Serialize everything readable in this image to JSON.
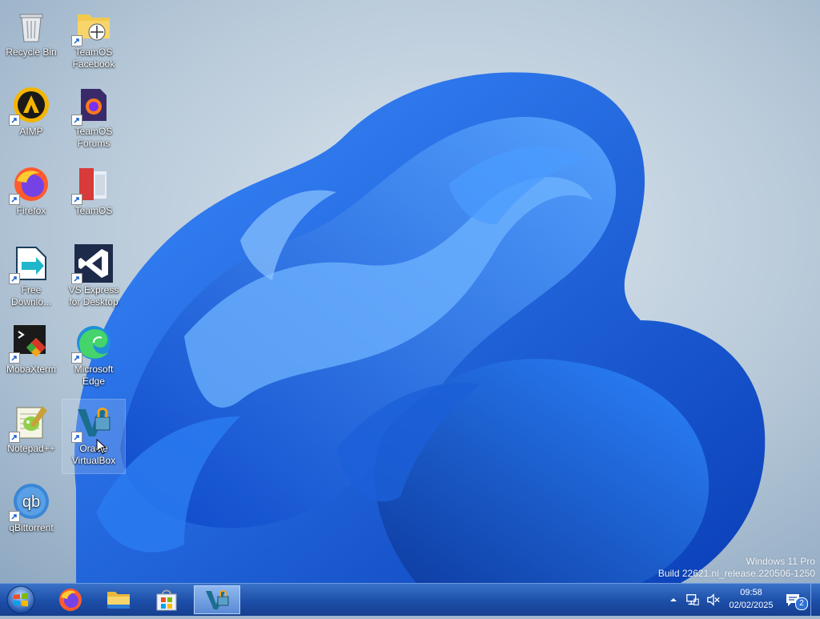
{
  "desktop": {
    "icons": [
      {
        "label": "Recycle Bin",
        "icon": "recycle-bin-icon"
      },
      {
        "label": "TeamOS Facebook",
        "icon": "folder-shortcut-icon"
      },
      {
        "label": "AIMP",
        "icon": "aimp-icon"
      },
      {
        "label": "TeamOS Forums",
        "icon": "firefox-document-icon"
      },
      {
        "label": "Firefox",
        "icon": "firefox-icon"
      },
      {
        "label": "TeamOS",
        "icon": "teamos-icon"
      },
      {
        "label": "Free Downlo...",
        "icon": "free-download-manager-icon"
      },
      {
        "label": "VS Express for Desktop",
        "icon": "visual-studio-icon"
      },
      {
        "label": "MobaXterm",
        "icon": "mobaxterm-icon"
      },
      {
        "label": "Microsoft Edge",
        "icon": "edge-icon"
      },
      {
        "label": "Notepad++",
        "icon": "notepad-plus-plus-icon"
      },
      {
        "label": "Oracle VirtualBox",
        "icon": "virtualbox-icon"
      },
      {
        "label": "qBittorrent",
        "icon": "qbittorrent-icon"
      }
    ]
  },
  "taskbar": {
    "pinned": [
      {
        "name": "Start",
        "icon": "windows-start-icon"
      },
      {
        "name": "Firefox",
        "icon": "firefox-icon"
      },
      {
        "name": "File Explorer",
        "icon": "folder-icon"
      },
      {
        "name": "Microsoft Store",
        "icon": "store-icon"
      },
      {
        "name": "Oracle VirtualBox",
        "icon": "virtualbox-icon",
        "active": true
      }
    ],
    "tray": {
      "clock_time": "09:58",
      "clock_date": "02/02/2025",
      "notification_count": "2"
    }
  },
  "watermark": {
    "line1": "Windows 11 Pro",
    "line2": "Build 22621.ni_release.220506-1250"
  },
  "colors": {
    "taskbar": "#1c4ea8",
    "wallpaper_bloom": "#1a6ee8",
    "wallpaper_bg": "#b8c9d8"
  }
}
